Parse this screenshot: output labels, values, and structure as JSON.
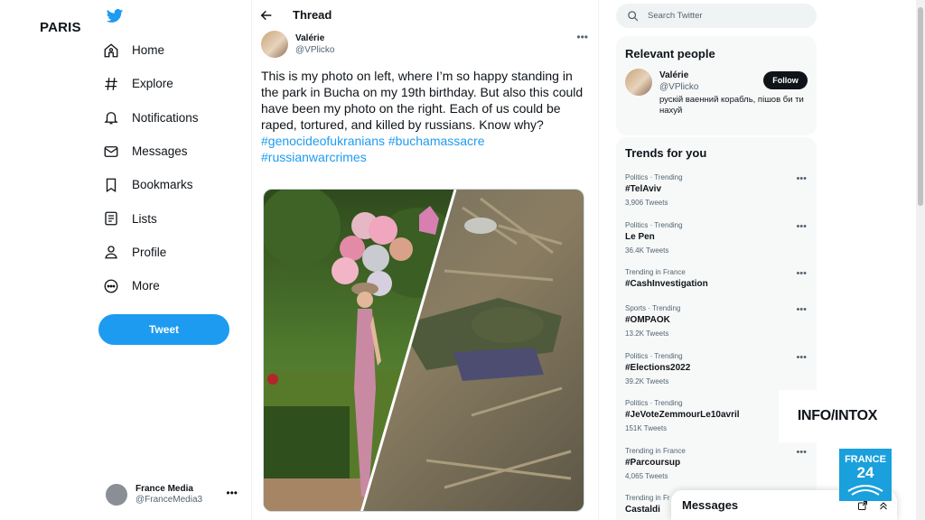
{
  "overlay": {
    "location": "PARIS",
    "show_name": "INFO/INTOX",
    "channel_line1": "FRANCE",
    "channel_line2": "24"
  },
  "sidebar": {
    "items": [
      {
        "label": "Home",
        "icon": "home-icon"
      },
      {
        "label": "Explore",
        "icon": "hashtag-icon"
      },
      {
        "label": "Notifications",
        "icon": "bell-icon"
      },
      {
        "label": "Messages",
        "icon": "mail-icon"
      },
      {
        "label": "Bookmarks",
        "icon": "bookmark-icon"
      },
      {
        "label": "Lists",
        "icon": "list-icon"
      },
      {
        "label": "Profile",
        "icon": "person-icon"
      },
      {
        "label": "More",
        "icon": "more-circle-icon"
      }
    ],
    "tweet_label": "Tweet",
    "account": {
      "name": "France Media",
      "handle": "@FranceMedia3"
    }
  },
  "thread": {
    "title": "Thread",
    "author": {
      "name": "Valérie",
      "handle": "@VPlicko"
    },
    "text": "This is my photo on left, where I’m so happy standing in the park in Bucha on my 19th birthday. But also this could have been my photo on the right. Each of us could be raped, tortured, and killed by russians. Know why?",
    "hashtags": [
      "#genocideofukranians",
      "#buchamassacre",
      "#russianwarcrimes"
    ]
  },
  "search": {
    "placeholder": "Search Twitter"
  },
  "relevant": {
    "title": "Relevant people",
    "person": {
      "name": "Valérie",
      "handle": "@VPlicko",
      "bio": "рускій ваенний корабль, пішов би ти нахуй",
      "follow_label": "Follow"
    }
  },
  "trends": {
    "title": "Trends for you",
    "items": [
      {
        "context": "Politics · Trending",
        "name": "#TelAviv",
        "count": "3,906 Tweets"
      },
      {
        "context": "Politics · Trending",
        "name": "Le Pen",
        "count": "36.4K Tweets"
      },
      {
        "context": "Trending in France",
        "name": "#CashInvestigation",
        "count": ""
      },
      {
        "context": "Sports · Trending",
        "name": "#OMPAOK",
        "count": "13.2K Tweets"
      },
      {
        "context": "Politics · Trending",
        "name": "#Elections2022",
        "count": "39.2K Tweets"
      },
      {
        "context": "Politics · Trending",
        "name": "#JeVoteZemmourLe10avril",
        "count": "151K Tweets"
      },
      {
        "context": "Trending in France",
        "name": "#Parcoursup",
        "count": "4,065 Tweets"
      },
      {
        "context": "Trending in Fr",
        "name": "Castaldi",
        "count": ""
      }
    ]
  },
  "messages_bar": {
    "title": "Messages"
  },
  "colors": {
    "accent": "#1d9bf0",
    "text": "#0f1419",
    "muted": "#536471",
    "panel": "#f7f9f9"
  }
}
